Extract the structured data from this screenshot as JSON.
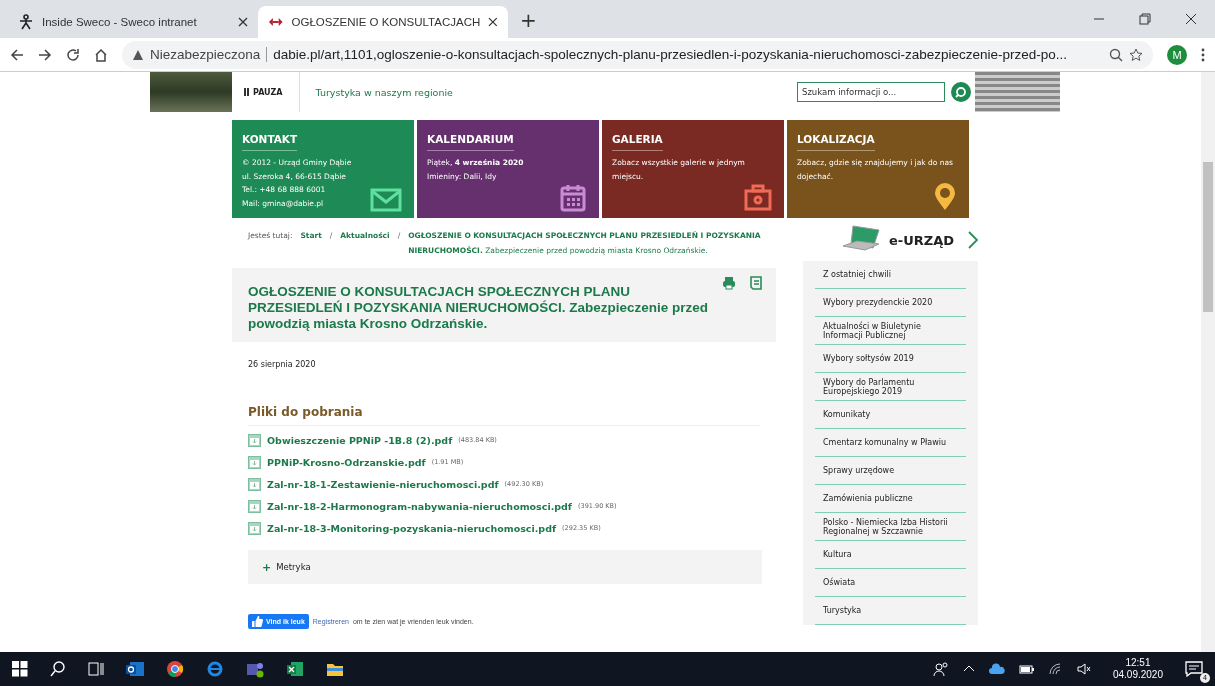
{
  "browser": {
    "tabs": [
      {
        "title": "Inside Sweco - Sweco intranet",
        "selected": false
      },
      {
        "title": "OGŁOSZENIE O KONSULTACJACH",
        "selected": true
      }
    ],
    "new_tab": "+",
    "address": {
      "security": "Niezabezpieczona",
      "url": "dabie.pl/art,1101,ogloszenie-o-konsultacjach-spolecznych-planu-przesiedlen-i-pozyskania-nieruchomosci-zabezpieczenie-przed-po..."
    },
    "profile": "M"
  },
  "header": {
    "pause": "PAUZA",
    "link": "Turystyka w naszym regionie",
    "search": {
      "placeholder": "Szukam informacji o..."
    }
  },
  "tiles": [
    {
      "title": "KONTAKT",
      "color": "#1e8a55",
      "lines": [
        "© 2012 - Urząd Gminy Dąbie",
        "ul. Szeroka 4, 66-615 Dąbie",
        "Tel.: +48 68 888 6001",
        "Mail: gmina@dabie.pl"
      ]
    },
    {
      "title": "KALENDARIUM",
      "color": "#66306e",
      "lines": [
        "Piątek, **4 września 2020**",
        "Imieniny: Dalii, Idy"
      ]
    },
    {
      "title": "GALERIA",
      "color": "#7a2a22",
      "lines": [
        "Zobacz wszystkie galerie w jednym miejscu."
      ]
    },
    {
      "title": "LOKALIZACJA",
      "color": "#7a531c",
      "lines": [
        "Zobacz, gdzie się znajdujemy i jak do nas dojechać."
      ]
    }
  ],
  "breadcrumb": {
    "label": "Jesteś tutaj:",
    "separators": [
      "/",
      "/"
    ],
    "items": [
      "Start",
      "Aktualności",
      "**OGŁOSZENIE O KONSULTACJACH SPOŁECZNYCH PLANU PRZESIEDLEŃ I POZYSKANIA NIERUCHOMOŚCI.** Zabezpieczenie przed powodzią miasta Krosno Odrzańskie."
    ]
  },
  "article": {
    "title": "OGŁOSZENIE O KONSULTACJACH SPOŁECZNYCH PLANU PRZESIEDLEŃ I POZYSKANIA NIERUCHOMOŚCI. Zabezpieczenie przed powodzią miasta Krosno Odrzańskie.",
    "date": "26 sierpnia 2020",
    "downloads_heading": "Pliki do pobrania",
    "files": [
      {
        "name": "Obwieszczenie PPNiP -1B.8 (2).pdf",
        "size": "(483.84 KB)"
      },
      {
        "name": "PPNiP-Krosno-Odrzanskie.pdf",
        "size": "(1.91 MB)"
      },
      {
        "name": "Zal-nr-18-1-Zestawienie-nieruchomosci.pdf",
        "size": "(492.30 KB)"
      },
      {
        "name": "Zal-nr-18-2-Harmonogram-nabywania-nieruchomosci.pdf",
        "size": "(391.90 KB)"
      },
      {
        "name": "Zal-nr-18-3-Monitoring-pozyskania-nieruchomosci.pdf",
        "size": "(292.35 KB)"
      }
    ],
    "metryka": {
      "toggle": "+",
      "label": "Metryka",
      "expanded": false
    }
  },
  "facebook": {
    "button": "Vind ik leuk",
    "link": "Registreren",
    "text": "om te zien wat je vrienden leuk vinden."
  },
  "sidebar": {
    "eurzad": "e-URZĄD",
    "items": [
      "Z ostatniej chwili",
      "Wybory prezydenckie 2020",
      "Aktualności w Biuletynie Informacji Publicznej",
      "Wybory sołtysów 2019",
      "Wybory do Parlamentu Europejskiego 2019",
      "Komunikaty",
      "Cmentarz komunalny w Pławiu",
      "Sprawy urzędowe",
      "Zamówienia publiczne",
      "Polsko - Niemiecka Izba Historii Regionalnej w Szczawnie",
      "Kultura",
      "Oświata",
      "Turystyka"
    ]
  },
  "taskbar": {
    "time": "12:51",
    "date": "04.09.2020",
    "notifications": "4"
  }
}
